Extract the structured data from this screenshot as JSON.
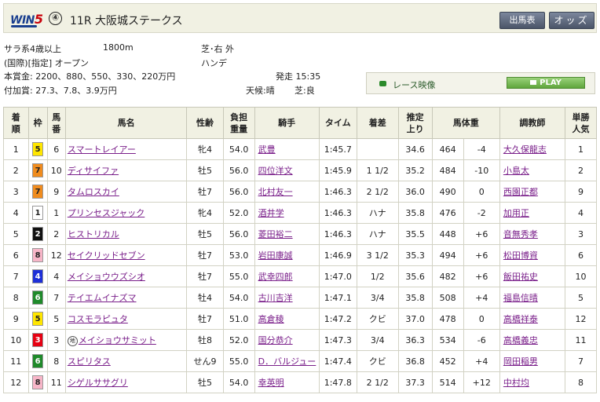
{
  "header": {
    "logo_text": "WIN",
    "logo_num": "5",
    "leg_no": "④",
    "race_title": "11R 大阪城ステークス",
    "btn_shutsuba": "出馬表",
    "btn_odds": "オッズ"
  },
  "race_info": {
    "class": "サラ系4歳以上",
    "distance": "1800m",
    "course": "芝･右 外",
    "conditions": "(国際)[指定] オープン",
    "weight_rule": "ハンデ",
    "prize_label": "本賞金:",
    "prize": "2200、880、550、330、220万円",
    "post_time": "発走 15:35",
    "bonus_label": "付加賞:",
    "bonus": "27.3、7.8、3.9万円",
    "weather": "天候:晴",
    "going": "芝:良"
  },
  "video": {
    "label": "レース映像",
    "play": "PLAY"
  },
  "colors": {
    "waku": {
      "1": {
        "bg": "#ffffff",
        "fg": "#222222"
      },
      "2": {
        "bg": "#111111",
        "fg": "#ffffff"
      },
      "3": {
        "bg": "#e60012",
        "fg": "#ffffff"
      },
      "4": {
        "bg": "#1d2fd8",
        "fg": "#ffffff"
      },
      "5": {
        "bg": "#ffe600",
        "fg": "#222222"
      },
      "6": {
        "bg": "#1f8a2a",
        "fg": "#ffffff"
      },
      "7": {
        "bg": "#f08c1e",
        "fg": "#222222"
      },
      "8": {
        "bg": "#f7b6c8",
        "fg": "#222222"
      }
    }
  },
  "table": {
    "headers": [
      "着順",
      "枠",
      "馬番",
      "馬名",
      "性齢",
      "負担重量",
      "騎手",
      "タイム",
      "着差",
      "推定上り",
      "馬体重",
      "",
      "調教師",
      "単勝人気"
    ],
    "rows": [
      {
        "rank": "1",
        "waku": "5",
        "num": "6",
        "horse": "スマートレイアー",
        "mark": "",
        "sex": "牝4",
        "weight": "54.0",
        "jockey": "武豊",
        "time": "1:45.7",
        "margin": "",
        "last3f": "34.6",
        "body": "464",
        "diff": "-4",
        "trainer": "大久保龍志",
        "pop": "1"
      },
      {
        "rank": "2",
        "waku": "7",
        "num": "10",
        "horse": "ディサイファ",
        "mark": "",
        "sex": "牡5",
        "weight": "56.0",
        "jockey": "四位洋文",
        "time": "1:45.9",
        "margin": "1 1/2",
        "last3f": "35.2",
        "body": "484",
        "diff": "-10",
        "trainer": "小島太",
        "pop": "2"
      },
      {
        "rank": "3",
        "waku": "7",
        "num": "9",
        "horse": "タムロスカイ",
        "mark": "",
        "sex": "牡7",
        "weight": "56.0",
        "jockey": "北村友一",
        "time": "1:46.3",
        "margin": "2 1/2",
        "last3f": "36.0",
        "body": "490",
        "diff": "0",
        "trainer": "西園正都",
        "pop": "9"
      },
      {
        "rank": "4",
        "waku": "1",
        "num": "1",
        "horse": "プリンセスジャック",
        "mark": "",
        "sex": "牝4",
        "weight": "52.0",
        "jockey": "酒井学",
        "time": "1:46.3",
        "margin": "ハナ",
        "last3f": "35.8",
        "body": "476",
        "diff": "-2",
        "trainer": "加用正",
        "pop": "4"
      },
      {
        "rank": "5",
        "waku": "2",
        "num": "2",
        "horse": "ヒストリカル",
        "mark": "",
        "sex": "牡5",
        "weight": "56.0",
        "jockey": "菱田裕二",
        "time": "1:46.3",
        "margin": "ハナ",
        "last3f": "35.5",
        "body": "448",
        "diff": "+6",
        "trainer": "音無秀孝",
        "pop": "3"
      },
      {
        "rank": "6",
        "waku": "8",
        "num": "12",
        "horse": "セイクリッドセブン",
        "mark": "",
        "sex": "牡7",
        "weight": "53.0",
        "jockey": "岩田康誠",
        "time": "1:46.9",
        "margin": "3 1/2",
        "last3f": "35.3",
        "body": "494",
        "diff": "+6",
        "trainer": "松田博資",
        "pop": "6"
      },
      {
        "rank": "7",
        "waku": "4",
        "num": "4",
        "horse": "メイショウウズシオ",
        "mark": "",
        "sex": "牡7",
        "weight": "55.0",
        "jockey": "武幸四郎",
        "time": "1:47.0",
        "margin": "1/2",
        "last3f": "35.6",
        "body": "482",
        "diff": "+6",
        "trainer": "飯田祐史",
        "pop": "10"
      },
      {
        "rank": "8",
        "waku": "6",
        "num": "7",
        "horse": "テイエムイナズマ",
        "mark": "",
        "sex": "牡4",
        "weight": "54.0",
        "jockey": "古川吉洋",
        "time": "1:47.1",
        "margin": "3/4",
        "last3f": "35.8",
        "body": "508",
        "diff": "+4",
        "trainer": "福島信晴",
        "pop": "5"
      },
      {
        "rank": "9",
        "waku": "5",
        "num": "5",
        "horse": "コスモラピュタ",
        "mark": "",
        "sex": "牡7",
        "weight": "51.0",
        "jockey": "高倉稜",
        "time": "1:47.2",
        "margin": "クビ",
        "last3f": "37.0",
        "body": "478",
        "diff": "0",
        "trainer": "高橋祥泰",
        "pop": "12"
      },
      {
        "rank": "10",
        "waku": "3",
        "num": "3",
        "horse": "メイショウサミット",
        "mark": "地",
        "sex": "牡8",
        "weight": "52.0",
        "jockey": "国分恭介",
        "time": "1:47.3",
        "margin": "3/4",
        "last3f": "36.3",
        "body": "534",
        "diff": "-6",
        "trainer": "高橋義忠",
        "pop": "11"
      },
      {
        "rank": "11",
        "waku": "6",
        "num": "8",
        "horse": "スピリタス",
        "mark": "",
        "sex": "せん9",
        "weight": "55.0",
        "jockey": "D．バルジュー",
        "time": "1:47.4",
        "margin": "クビ",
        "last3f": "36.8",
        "body": "452",
        "diff": "+4",
        "trainer": "岡田稲男",
        "pop": "7"
      },
      {
        "rank": "12",
        "waku": "8",
        "num": "11",
        "horse": "シゲルササグリ",
        "mark": "",
        "sex": "牡5",
        "weight": "54.0",
        "jockey": "幸英明",
        "time": "1:47.8",
        "margin": "2 1/2",
        "last3f": "37.3",
        "body": "514",
        "diff": "+12",
        "trainer": "中村均",
        "pop": "8"
      }
    ]
  }
}
